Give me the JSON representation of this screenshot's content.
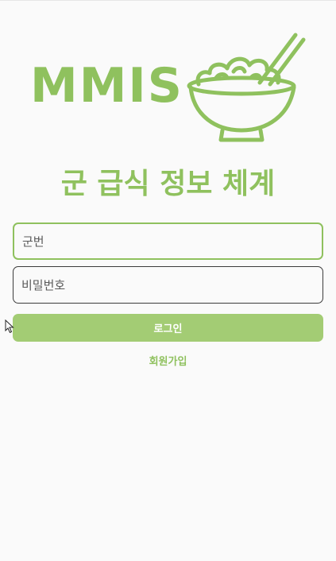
{
  "logo": {
    "text": "MMIS",
    "icon": "rice-bowl-with-chopsticks-icon"
  },
  "title": "군 급식 정보 체계",
  "form": {
    "id_placeholder": "군번",
    "id_value": "",
    "password_placeholder": "비밀번호",
    "password_value": ""
  },
  "buttons": {
    "login_label": "로그인",
    "signup_label": "회원가입"
  },
  "colors": {
    "accent": "#8fc15e",
    "button": "#a3cc74",
    "background": "#fafafa"
  }
}
